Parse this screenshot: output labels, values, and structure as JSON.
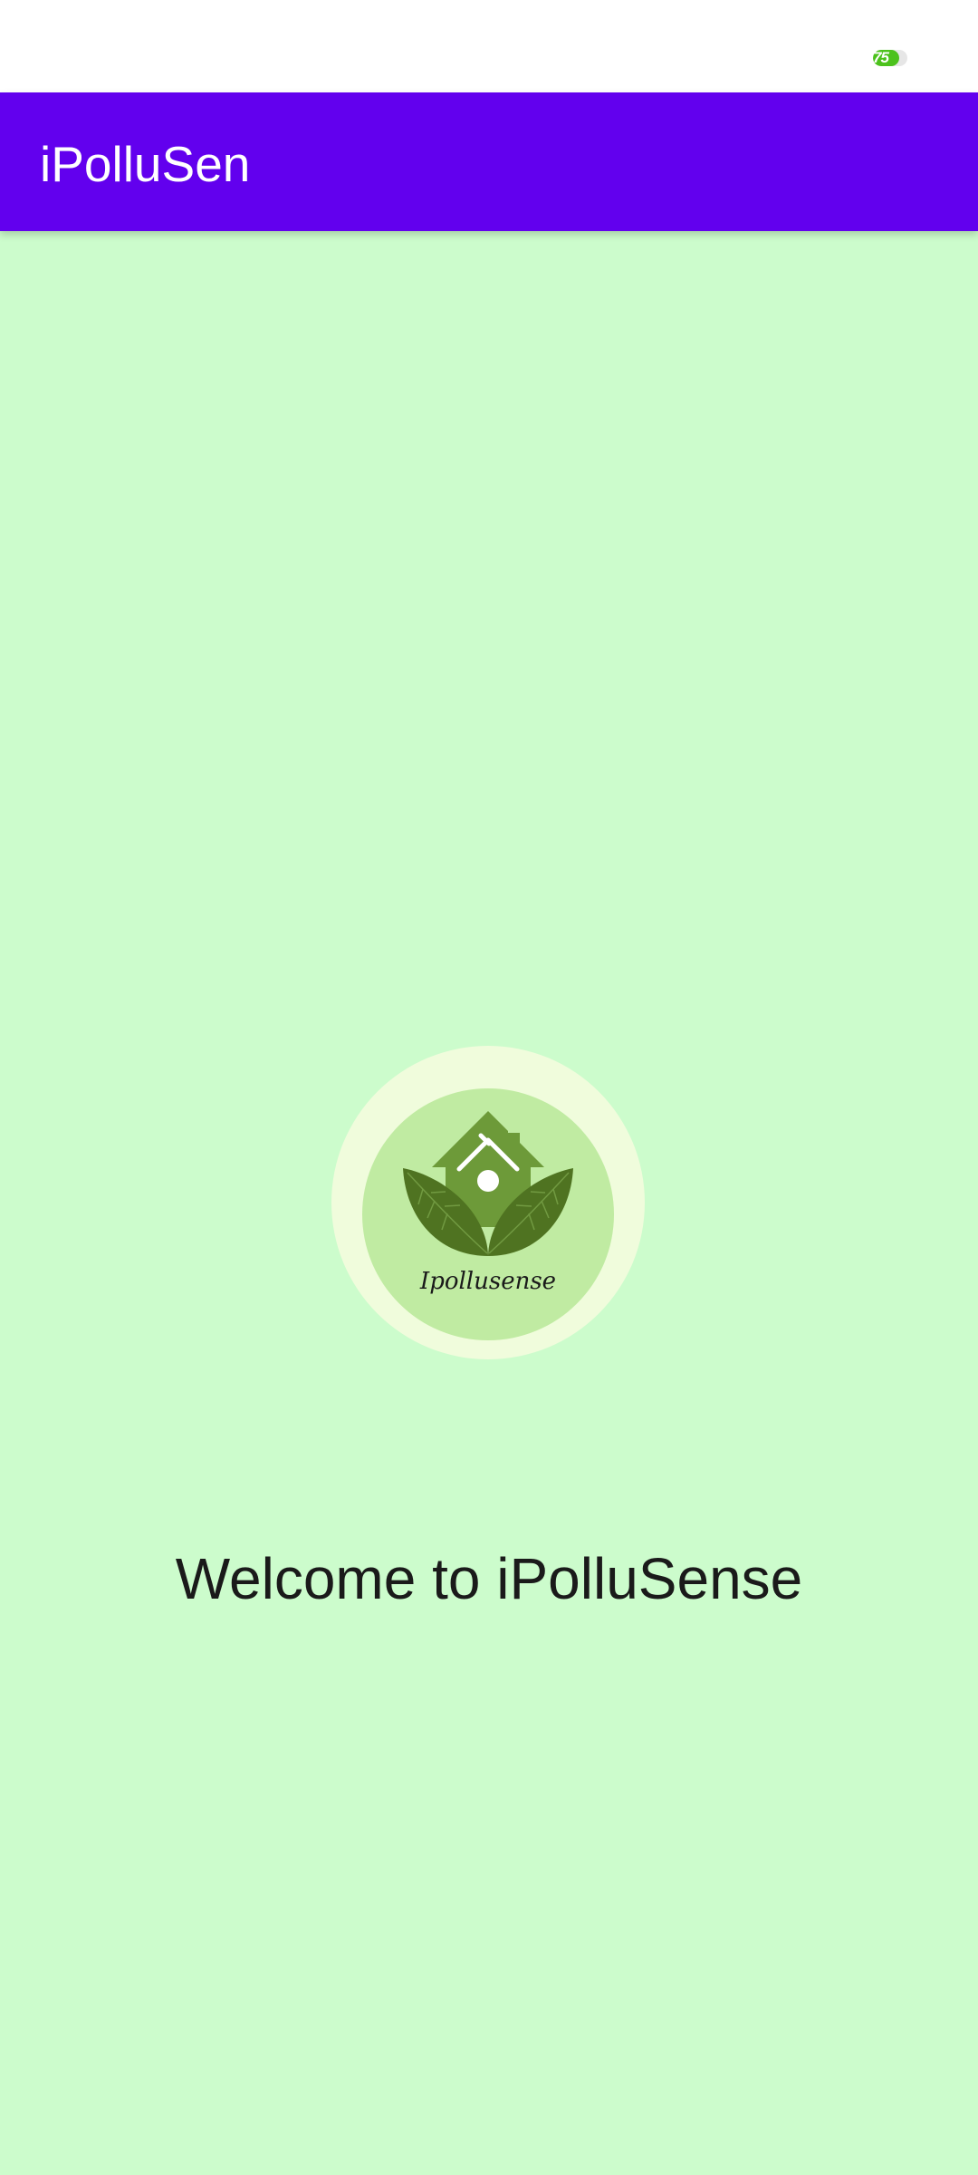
{
  "status_bar": {
    "battery_level": "75",
    "battery_fraction": 0.75,
    "battery_color": "#4cc21c"
  },
  "app_bar": {
    "title": "iPolluSen",
    "color": "#6200ee"
  },
  "logo": {
    "icon": "house-leaf-logo",
    "caption": "Ipollusense"
  },
  "welcome": {
    "text": "Welcome to iPolluSense"
  },
  "colors": {
    "background": "#ccfccc",
    "logo_outer": "#f0fcdc",
    "logo_inner": "#c0eba2",
    "leaf_dark": "#4f7321",
    "house_green": "#6d9a39"
  }
}
